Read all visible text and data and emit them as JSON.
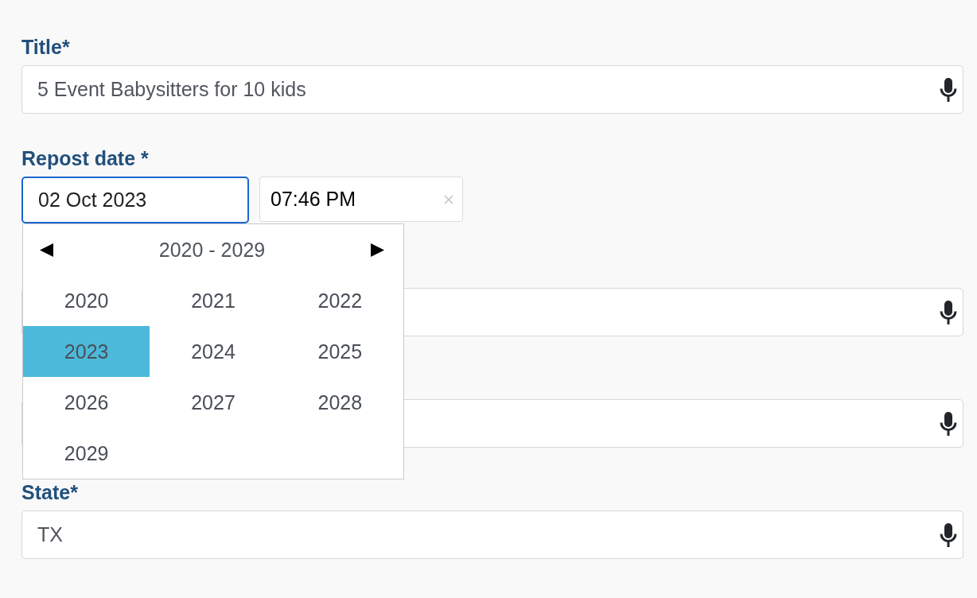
{
  "form": {
    "fields": [
      {
        "kind": "text",
        "label": "Title*",
        "value": "5 Event Babysitters for 10 kids"
      },
      {
        "kind": "datetime",
        "label": "Repost date *",
        "date": {
          "value": "02 Oct 2023",
          "focused": true
        },
        "time": {
          "value": "07:46 PM"
        },
        "year_picker": {
          "range": "2020 - 2029",
          "years": [
            {
              "label": "2020",
              "selected": false
            },
            {
              "label": "2021",
              "selected": false
            },
            {
              "label": "2022",
              "selected": false
            },
            {
              "label": "2023",
              "selected": true
            },
            {
              "label": "2024",
              "selected": false
            },
            {
              "label": "2025",
              "selected": false
            },
            {
              "label": "2026",
              "selected": false
            },
            {
              "label": "2027",
              "selected": false
            },
            {
              "label": "2028",
              "selected": false
            },
            {
              "label": "2029",
              "selected": false
            }
          ]
        }
      },
      {
        "kind": "text"
      },
      {
        "kind": "text"
      },
      {
        "kind": "text",
        "label": "State*",
        "value": "TX"
      }
    ]
  }
}
